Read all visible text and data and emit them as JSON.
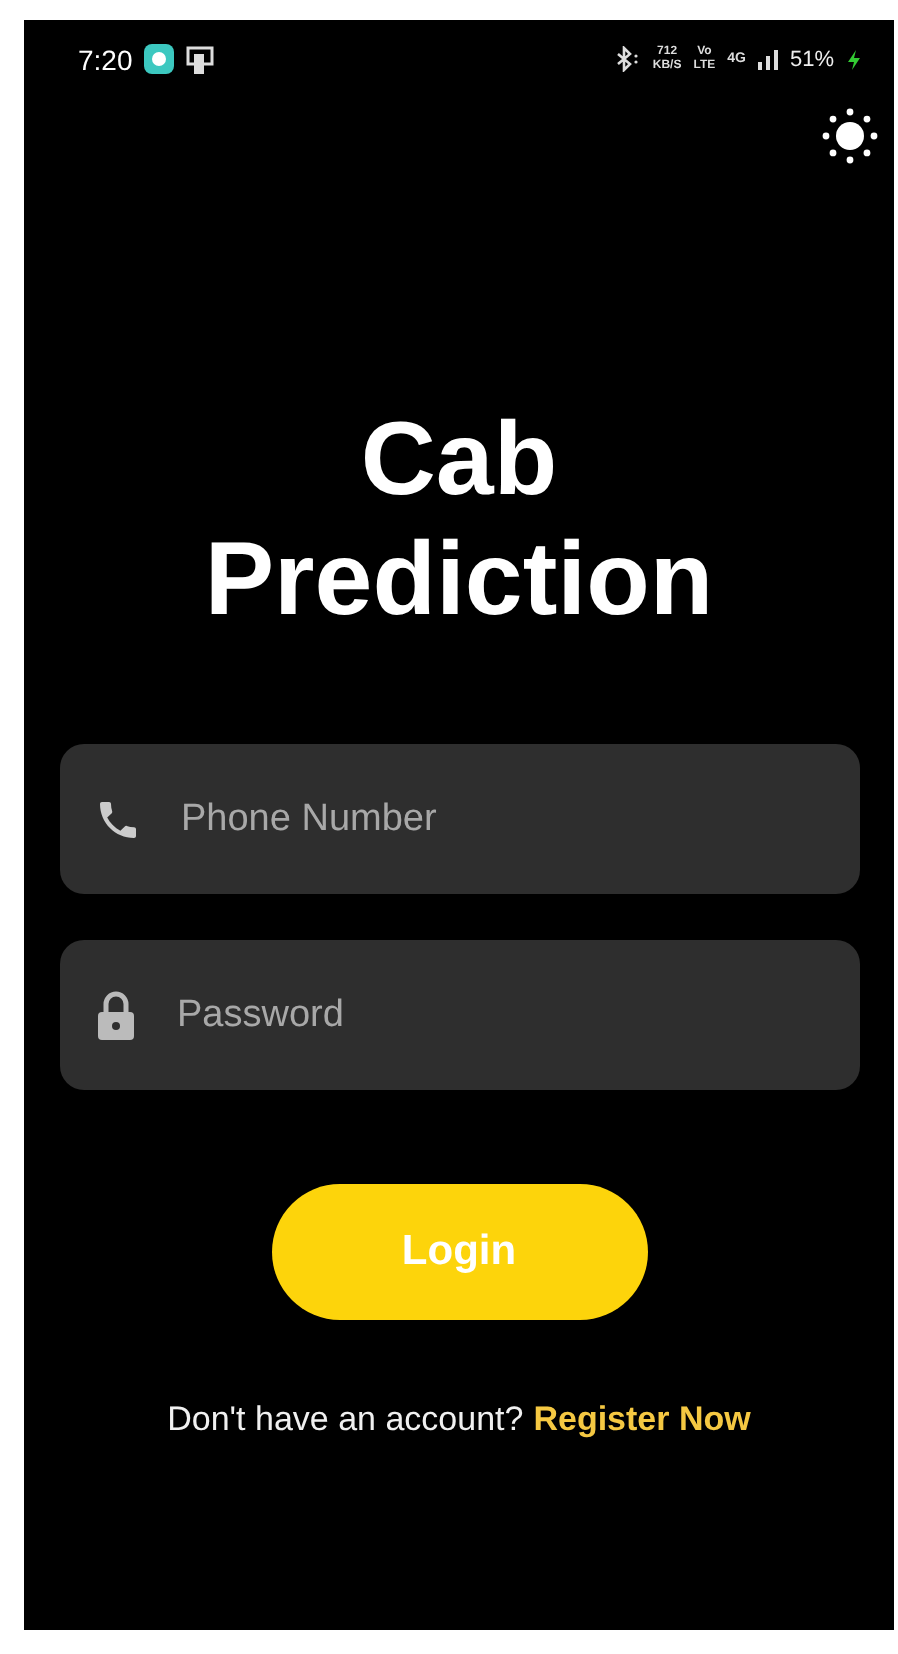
{
  "status_bar": {
    "time": "7:20",
    "speed": "712",
    "speed_unit": "KB/S",
    "volte_top": "Vo",
    "volte_bottom": "LTE",
    "network": "4G",
    "battery": "51%"
  },
  "title": "Cab Prediction",
  "fields": [
    {
      "kind": "phone",
      "placeholder": "Phone Number"
    },
    {
      "kind": "password",
      "placeholder": "Password"
    }
  ],
  "login_button": "Login",
  "register": {
    "prompt": "Don't have an account?",
    "link": "Register Now"
  }
}
